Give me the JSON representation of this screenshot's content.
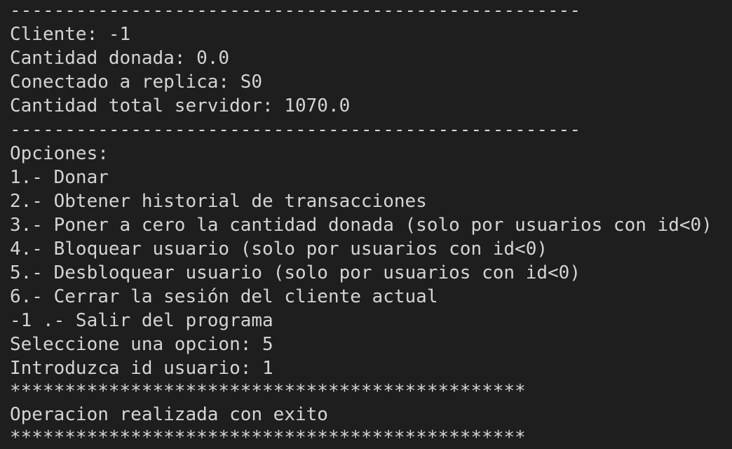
{
  "terminal": {
    "background": "#1e1e1e",
    "foreground": "#d4d4d4",
    "lines": [
      "----------------------------------------------------",
      "Cliente: -1",
      "Cantidad donada: 0.0",
      "Conectado a replica: S0",
      "Cantidad total servidor: 1070.0",
      "----------------------------------------------------",
      "Opciones:",
      "1.- Donar",
      "2.- Obtener historial de transacciones",
      "3.- Poner a cero la cantidad donada (solo por usuarios con id<0)",
      "4.- Bloquear usuario (solo por usuarios con id<0)",
      "5.- Desbloquear usuario (solo por usuarios con id<0)",
      "6.- Cerrar la sesión del cliente actual",
      "-1 .- Salir del programa",
      "Seleccione una opcion: 5",
      "Introduzca id usuario: 1",
      "***********************************************",
      "Operacion realizada con exito",
      "***********************************************"
    ]
  }
}
